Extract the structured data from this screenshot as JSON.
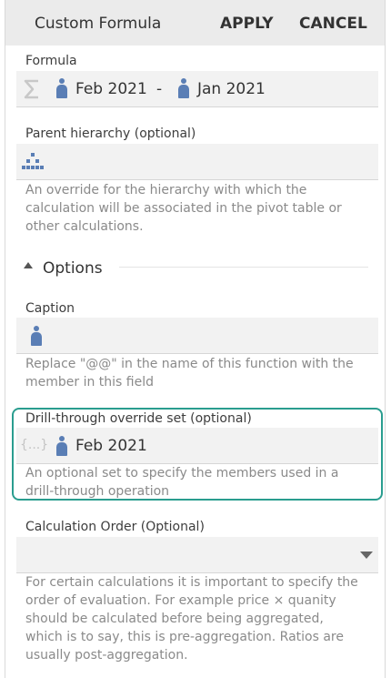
{
  "header": {
    "title": "Custom Formula",
    "apply_label": "APPLY",
    "cancel_label": "CANCEL"
  },
  "formula": {
    "label": "Formula",
    "member_1": "Feb 2021",
    "operator": "-",
    "member_2": "Jan 2021"
  },
  "parent_hierarchy": {
    "label": "Parent hierarchy (optional)",
    "hint": "An override for the hierarchy with which the calculation will be associated in the pivot table or other calculations."
  },
  "options": {
    "title": "Options"
  },
  "caption": {
    "label": "Caption",
    "hint": "Replace \"@@\" in the name of this function with the member in this field"
  },
  "drill_through": {
    "label": "Drill-through override set (optional)",
    "set_icon_text": "{...}",
    "member": "Feb 2021",
    "hint": "An optional set to specify the members used in a drill-through operation"
  },
  "calculation_order": {
    "label": "Calculation Order (Optional)",
    "selected_value": "",
    "hint": "For certain calculations it is important to specify the order of evaluation. For example price × quanity should be calculated before being aggregated, which is to say, this is pre-aggregation. Ratios are usually post-aggregation."
  },
  "colors": {
    "accent_teal": "#2a9d8f",
    "member_icon_blue": "#5a7eb5"
  }
}
